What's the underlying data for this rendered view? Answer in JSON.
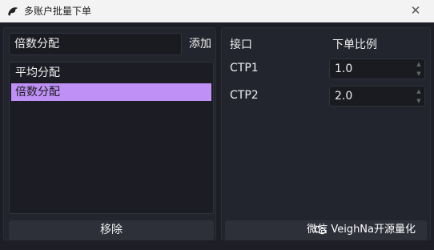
{
  "window": {
    "title": "多账户批量下单",
    "close_glyph": "✕"
  },
  "left": {
    "name_value": "倍数分配",
    "add_label": "添加",
    "items": [
      "平均分配",
      "倍数分配"
    ],
    "selected_index": 1,
    "remove_label": "移除"
  },
  "right": {
    "header_interface": "接口",
    "header_ratio": "下单比例",
    "rows": [
      {
        "interface": "CTP1",
        "ratio": "1.0"
      },
      {
        "interface": "CTP2",
        "ratio": "2.0"
      }
    ],
    "watermark": "微信 VeighNa开源量化"
  },
  "colors": {
    "selected": "#bf91f7",
    "background": "#1e1f26",
    "titlebar": "#f3f3f3"
  },
  "icons": {
    "app": "app-logo-icon",
    "close": "close-icon",
    "spin_up": "spin-up-icon",
    "spin_down": "spin-down-icon",
    "watermark": "wechat-icon"
  }
}
